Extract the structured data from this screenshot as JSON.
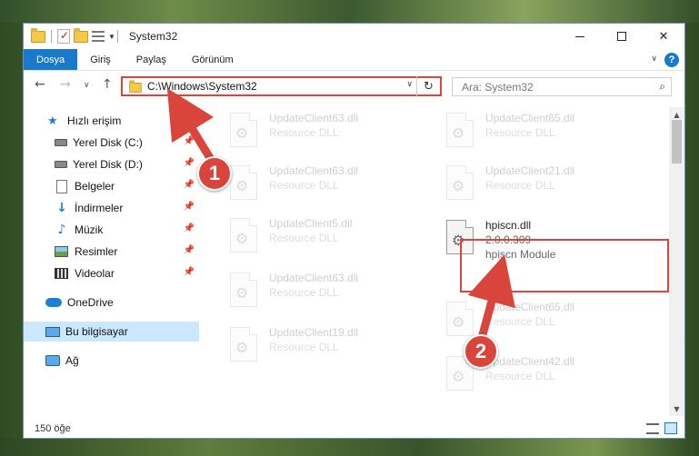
{
  "window": {
    "title": "System32"
  },
  "ribbon": {
    "tabs": [
      "Dosya",
      "Giriş",
      "Paylaş",
      "Görünüm"
    ],
    "help": "?"
  },
  "nav": {
    "address_path": "C:\\Windows\\System32",
    "search_placeholder": "Ara: System32"
  },
  "sidebar": {
    "quick_access": "Hızlı erişim",
    "items": [
      {
        "label": "Yerel Disk (C:)",
        "icon": "drive-icon"
      },
      {
        "label": "Yerel Disk (D:)",
        "icon": "drive-icon"
      },
      {
        "label": "Belgeler",
        "icon": "documents-icon"
      },
      {
        "label": "İndirmeler",
        "icon": "downloads-icon"
      },
      {
        "label": "Müzik",
        "icon": "music-icon"
      },
      {
        "label": "Resimler",
        "icon": "pictures-icon"
      },
      {
        "label": "Videolar",
        "icon": "videos-icon"
      }
    ],
    "onedrive": "OneDrive",
    "this_pc": "Bu bilgisayar",
    "network": "Ağ"
  },
  "files": {
    "left": [
      {
        "name": "UpdateClient63.dll",
        "type": "Resource DLL"
      },
      {
        "name": "UpdateClient63.dll",
        "type": "Resource DLL"
      },
      {
        "name": "UpdateClient5.dll",
        "type": "Resource DLL"
      },
      {
        "name": "UpdateClient63.dll",
        "type": "Resource DLL"
      },
      {
        "name": "UpdateClient19.dll",
        "type": "Resource DLL"
      }
    ],
    "right": [
      {
        "name": "UpdateClient65.dll",
        "type": "Resource DLL"
      },
      {
        "name": "UpdateClient21.dll",
        "type": "Resource DLL"
      },
      {
        "name": "UpdateClient65.dll",
        "type": "Resource DLL"
      },
      {
        "name": "UpdateClient42.dll",
        "type": "Resource DLL"
      }
    ],
    "highlighted": {
      "name": "hpiscn.dll",
      "version": "2.0.0.309",
      "description": "hpiscn Module"
    }
  },
  "status": {
    "item_count": "150 öğe"
  },
  "callouts": [
    "1",
    "2"
  ],
  "colors": {
    "accent": "#1979ca",
    "callout": "#d9453b",
    "selection": "#cce8ff"
  }
}
